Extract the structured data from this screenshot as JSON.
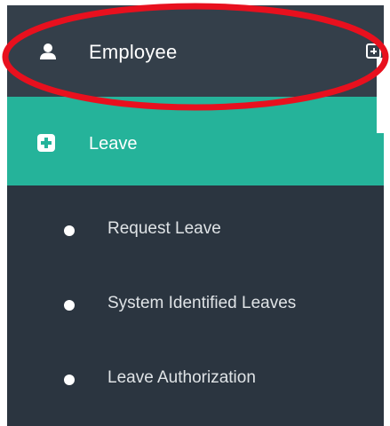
{
  "sidebar": {
    "employee": {
      "label": "Employee",
      "icon": "user-icon",
      "expand_icon": "plus-square-icon"
    },
    "leave": {
      "label": "Leave",
      "icon": "plus-square-icon",
      "active": true
    },
    "leave_submenu": [
      {
        "label": "Request Leave",
        "icon": "bullet-icon"
      },
      {
        "label": "System Identified Leaves",
        "icon": "bullet-icon"
      },
      {
        "label": "Leave Authorization",
        "icon": "bullet-icon"
      }
    ]
  },
  "colors": {
    "sidebar_bg": "#2b3540",
    "employee_bg": "#343f4a",
    "active_bg": "#25b39a",
    "annotation": "#e8101e"
  }
}
